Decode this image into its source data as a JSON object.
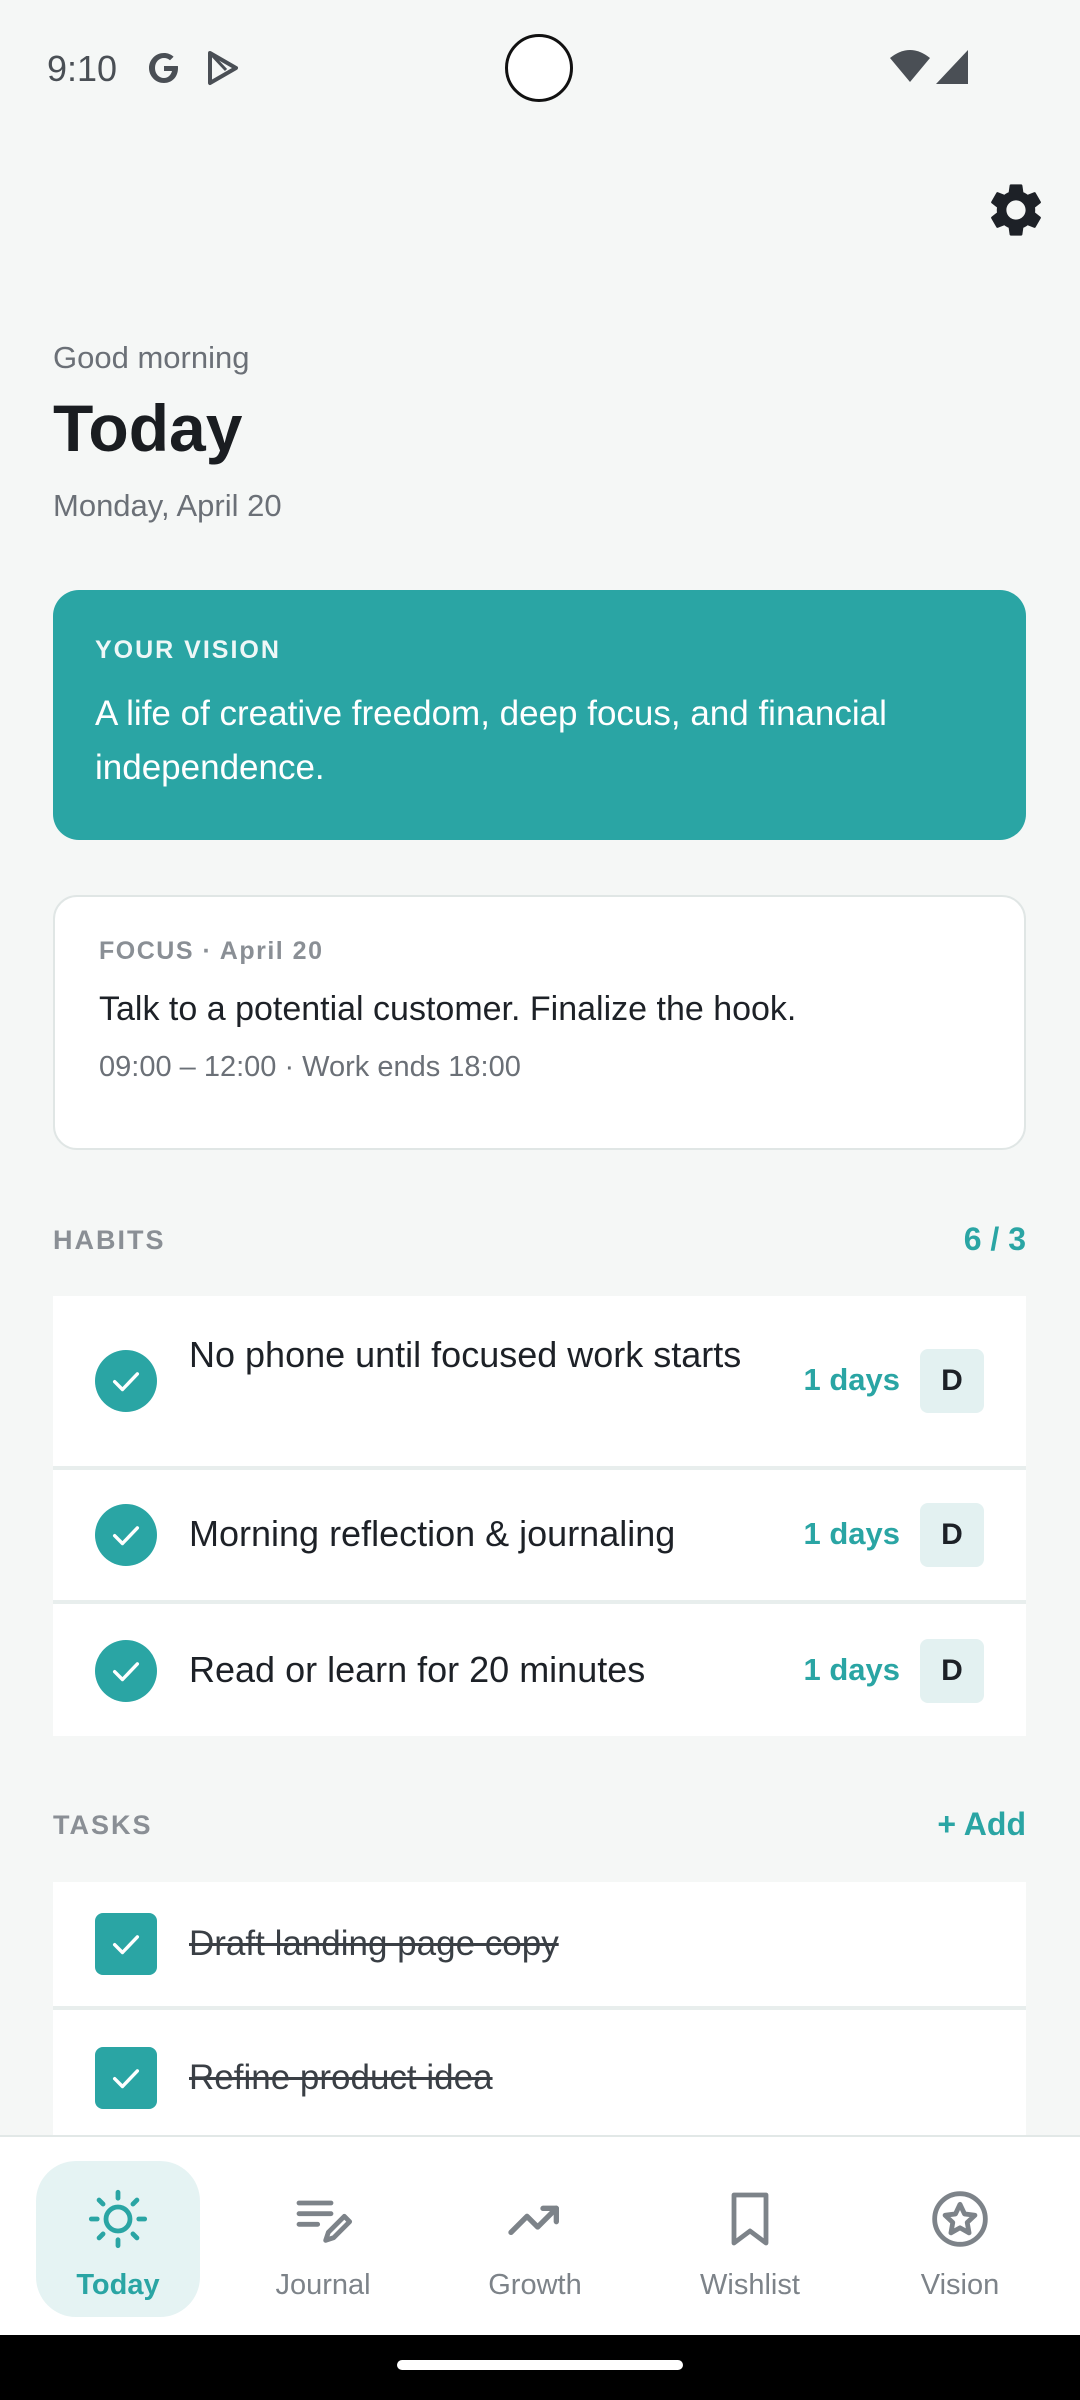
{
  "status": {
    "time": "9:10"
  },
  "header": {
    "greeting": "Good morning",
    "title": "Today",
    "date": "Monday, April 20"
  },
  "vision": {
    "label": "YOUR VISION",
    "text": "A life of creative freedom, deep focus, and financial independence."
  },
  "focus": {
    "label": "FOCUS · April 20",
    "text": "Talk to a potential customer. Finalize the hook.",
    "sub": "09:00 – 12:00 · Work ends 18:00"
  },
  "habits": {
    "label": "HABITS",
    "count": "6 / 3",
    "items": [
      {
        "text": "No phone until focused work starts",
        "streak": "1 days",
        "freq": "D"
      },
      {
        "text": "Morning reflection & journaling",
        "streak": "1 days",
        "freq": "D"
      },
      {
        "text": "Read or learn for 20 minutes",
        "streak": "1 days",
        "freq": "D"
      }
    ]
  },
  "tasks": {
    "label": "TASKS",
    "add_label": "+ Add",
    "items": [
      {
        "text": "Draft landing page copy"
      },
      {
        "text": "Refine product idea"
      }
    ]
  },
  "nav": {
    "items": [
      {
        "label": "Today",
        "icon": "sun-icon"
      },
      {
        "label": "Journal",
        "icon": "journal-edit-icon"
      },
      {
        "label": "Growth",
        "icon": "trend-up-icon"
      },
      {
        "label": "Wishlist",
        "icon": "bookmark-icon"
      },
      {
        "label": "Vision",
        "icon": "star-circle-icon"
      }
    ]
  },
  "colors": {
    "accent": "#2aa5a4",
    "background": "#f5f7f6",
    "active_nav_bg": "#e5f3f3"
  }
}
